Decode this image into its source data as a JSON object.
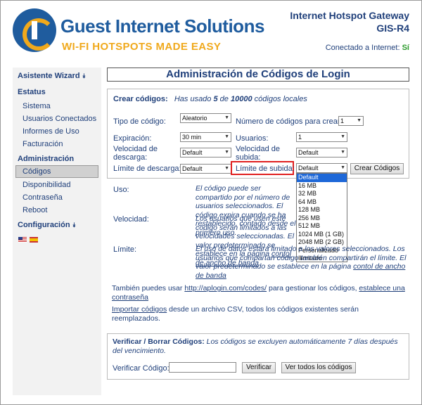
{
  "header": {
    "logo_title": "Guest Internet Solutions",
    "logo_subtitle": "WI-FI HOTSPOTS MADE EASY",
    "gateway_title": "Internet Hotspot Gateway",
    "gateway_model": "GIS-R4",
    "connected_label": "Conectado a Internet:",
    "connected_value": "Sí"
  },
  "sidebar": {
    "wizard": "Asistente Wizard",
    "status_head": "Estatus",
    "status_items": [
      "Sistema",
      "Usuarios Conectados",
      "Informes de Uso",
      "Facturación"
    ],
    "admin_head": "Administración",
    "admin_items": [
      "Códigos",
      "Disponibilidad",
      "Contraseña",
      "Reboot"
    ],
    "config": "Configuración",
    "flags": [
      "us-flag-icon",
      "es-flag-icon"
    ]
  },
  "main": {
    "title": "Administración de Códigos de Login",
    "create": {
      "head": "Crear códigos:",
      "usage_prefix": "Has usado",
      "used": "5",
      "usage_mid": "de",
      "total": "10000",
      "usage_suffix": "códigos locales",
      "type_label": "Tipo de código:",
      "type_value": "Aleatorio",
      "count_label": "Número de códigos para crear:",
      "count_value": "1",
      "exp_label": "Expiración:",
      "exp_value": "30 min",
      "users_label": "Usuarios:",
      "users_value": "1",
      "down_speed_label": "Velocidad de descarga:",
      "down_speed_value": "Default",
      "up_speed_label": "Velocidad de subida:",
      "up_speed_value": "Default",
      "down_limit_label": "Límite de descarga:",
      "down_limit_value": "Default",
      "up_limit_label": "Límite de subida:",
      "up_limit_value": "Default",
      "create_button": "Crear Códigos",
      "dropdown_options": [
        "Default",
        "16 MB",
        "32 MB",
        "64 MB",
        "128 MB",
        "256 MB",
        "512 MB",
        "1024 MB (1 GB)",
        "2048 MB (2 GB)",
        "Personalizado",
        "Ilimitado"
      ]
    },
    "help": {
      "uso_label": "Uso:",
      "uso_text": "El código puede ser compartido por el número de usuarios seleccionados. El código expira cuando se ha restablecido, contado desde el primero uso.",
      "vel_label": "Velocidad:",
      "vel_text_1": "Los usuarios que usen este código serán limitados a las velocidades seleccionadas. El valor predeterminado se establece en la página",
      "vel_link": "contol de ancho de banda",
      "lim_label": "Límite:",
      "lim_text_1": "El uso de datos estará limitado a los valores seleccionados. Los usuarios que compartan código también compartirán el límite. El valor predeterminado se establece en la página",
      "lim_link": "contol de ancho de banda",
      "manage_prefix": "También puedes usar",
      "manage_link": "http://aplogin.com/codes/",
      "manage_mid": "para gestionar los códigos,",
      "manage_link2": "establece una contraseña",
      "import_link": "Importar códigos",
      "import_text": "desde un archivo CSV, todos los códigos existentes serán reemplazados."
    },
    "verify": {
      "head": "Verificar / Borrar Códigos:",
      "note": "Los códigos se excluyen automáticamente 7 días después del vencimiento.",
      "code_label": "Verificar Código:",
      "code_value": "",
      "verify_button": "Verificar",
      "view_all_button": "Ver todos los códigos"
    }
  }
}
